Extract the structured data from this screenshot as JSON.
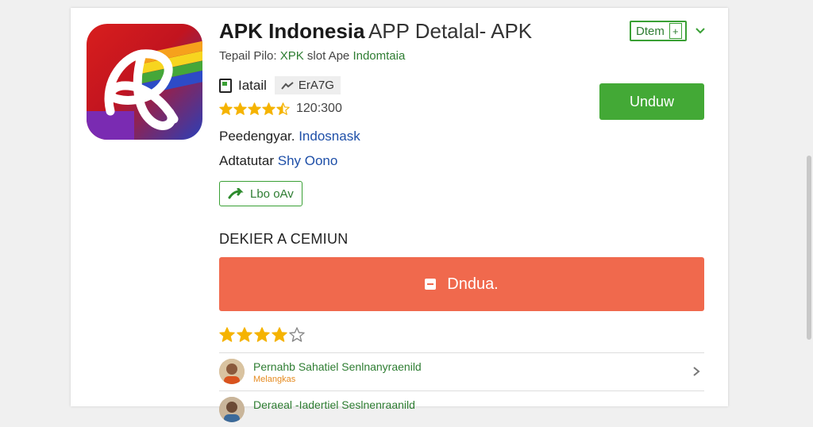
{
  "app": {
    "title_bold": "APK Indonesia",
    "title_rest": "APP Detalal- APK",
    "subtitle_prefix": "Tepail Pilo:",
    "subtitle_green1": "XPK",
    "subtitle_mid": "slot Ape",
    "subtitle_green2": "Indomtaia",
    "icon": "app-logo-icon"
  },
  "header": {
    "open_label": "Dtem",
    "open_plus": "+",
    "dropdown_icon": "chevron-down-icon"
  },
  "badges": {
    "badge1_label": "Iatail",
    "badge2_label": "ErA7G"
  },
  "rating": {
    "stars_filled": 4.5,
    "stars_total": 5,
    "count": "120:300"
  },
  "meta": {
    "developer_label": "Peedengyar.",
    "developer_value": "Indosnask",
    "category_label": "Adtatutar",
    "category_value": "Shy Oono"
  },
  "tag_button": {
    "label": "Lbo oAv"
  },
  "download_button": {
    "label": "Unduw"
  },
  "section": {
    "title": "DEKIER A CEMIUN",
    "big_button_label": "Dndua."
  },
  "rating2": {
    "stars_filled": 4,
    "stars_total": 5
  },
  "reviews": [
    {
      "name": "Pernahb Sahatiel Senlnanyraenild",
      "sub": "Melangkas"
    },
    {
      "name": "Deraeal -Iadertiel Seslnenraanild",
      "sub": ""
    }
  ],
  "colors": {
    "accent_green": "#43a936",
    "accent_orange": "#f0694d",
    "star": "#f5b301",
    "link_blue": "#1e4fa8"
  }
}
